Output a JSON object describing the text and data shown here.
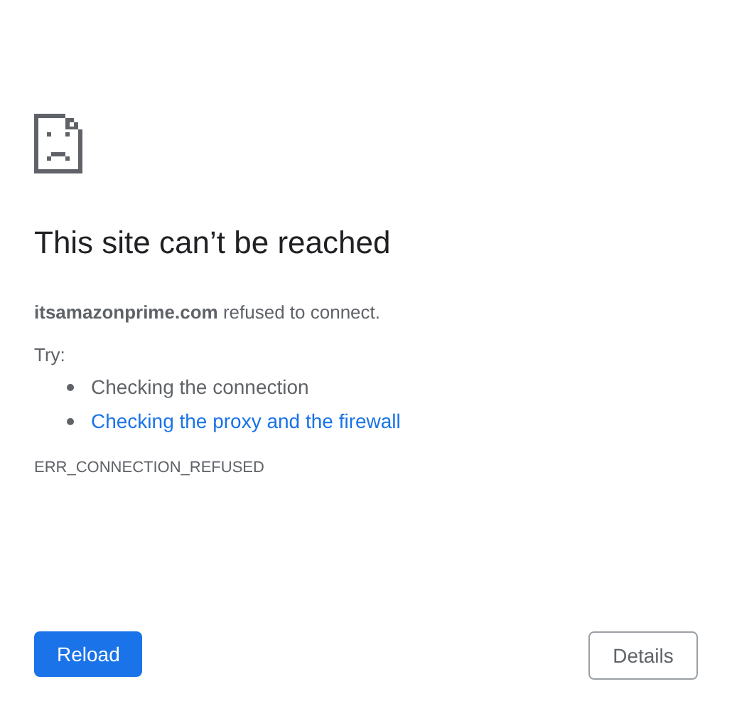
{
  "heading": "This site can’t be reached",
  "message": "**itsamazonprime.com** refused to connect.",
  "try_label": "Try:",
  "suggestions": [
    {
      "text": "Checking the connection",
      "kind": "text"
    },
    {
      "text": "Checking the proxy and the firewall",
      "kind": "link"
    }
  ],
  "error_code": "ERR_CONNECTION_REFUSED",
  "buttons": [
    {
      "label": "Reload",
      "kind": "primary"
    },
    {
      "label": "Details",
      "kind": "secondary"
    }
  ]
}
